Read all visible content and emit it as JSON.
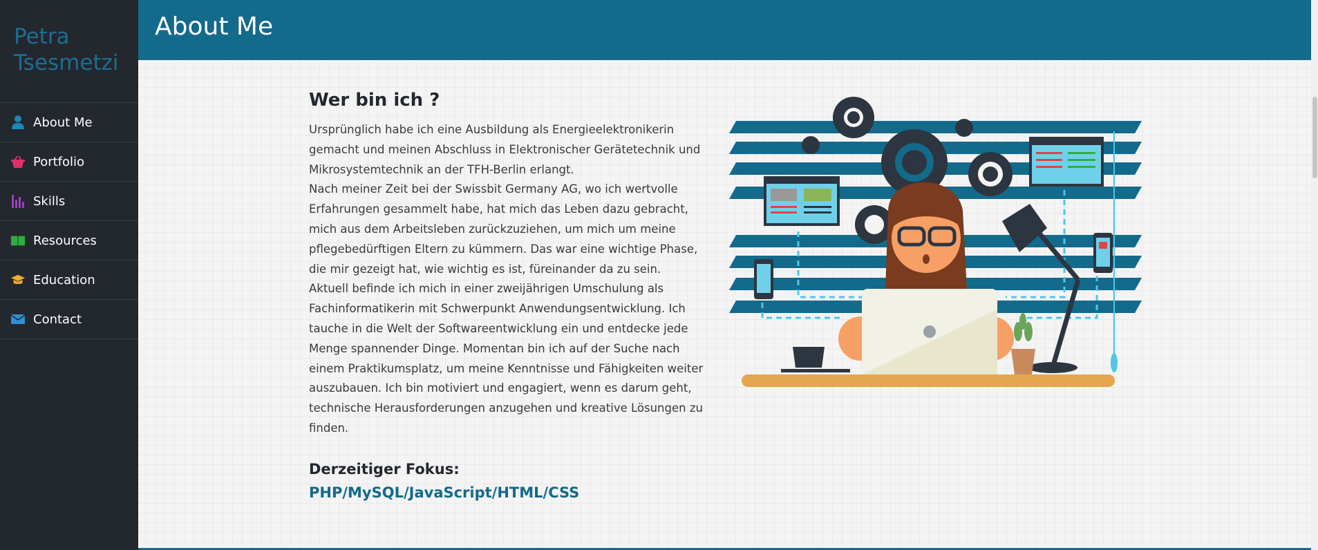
{
  "brand": {
    "name": "Petra Tsesmetzi"
  },
  "sidebar": {
    "items": [
      {
        "label": "About Me",
        "icon": "user-icon",
        "color": "#1d87b5"
      },
      {
        "label": "Portfolio",
        "icon": "basket-icon",
        "color": "#e0306b"
      },
      {
        "label": "Skills",
        "icon": "bar-chart-icon",
        "color": "#9b3fc2"
      },
      {
        "label": "Resources",
        "icon": "book-icon",
        "color": "#2fae3f"
      },
      {
        "label": "Education",
        "icon": "graduation-cap-icon",
        "color": "#f0a92e"
      },
      {
        "label": "Contact",
        "icon": "envelope-icon",
        "color": "#2f8fd3"
      }
    ]
  },
  "header": {
    "title": "About Me"
  },
  "main": {
    "heading": "Wer bin ich ?",
    "paragraphs": [
      "Ursprünglich habe ich eine Ausbildung als Energieelektronikerin gemacht und meinen Abschluss in Elektronischer Gerätetechnik und Mikrosystemtechnik an der TFH-Berlin erlangt.",
      "Nach meiner Zeit bei der Swissbit Germany AG, wo ich wertvolle Erfahrungen gesammelt habe, hat mich das Leben dazu gebracht, mich aus dem Arbeitsleben zurückzuziehen, um mich um meine pflegebedürftigen Eltern zu kümmern. Das war eine wichtige Phase, die mir gezeigt hat, wie wichtig es ist, füreinander da zu sein.",
      "Aktuell befinde ich mich in einer zweijährigen Umschulung als Fachinformatikerin mit Schwerpunkt Anwendungsentwicklung. Ich tauche in die Welt der Softwareentwicklung ein und entdecke jede Menge spannender Dinge. Momentan bin ich auf der Suche nach einem Praktikumsplatz, um meine Kenntnisse und Fähigkeiten weiter auszubauen. Ich bin motiviert und engagiert, wenn es darum geht, technische Herausforderungen anzugehen und kreative Lösungen zu finden."
    ],
    "focus_label": "Derzeitiger Fokus:",
    "focus_value": "PHP/MySQL/JavaScript/HTML/CSS"
  },
  "colors": {
    "accent": "#136a8b",
    "sidebar_bg": "#23272e",
    "background": "#f4f4f4"
  }
}
